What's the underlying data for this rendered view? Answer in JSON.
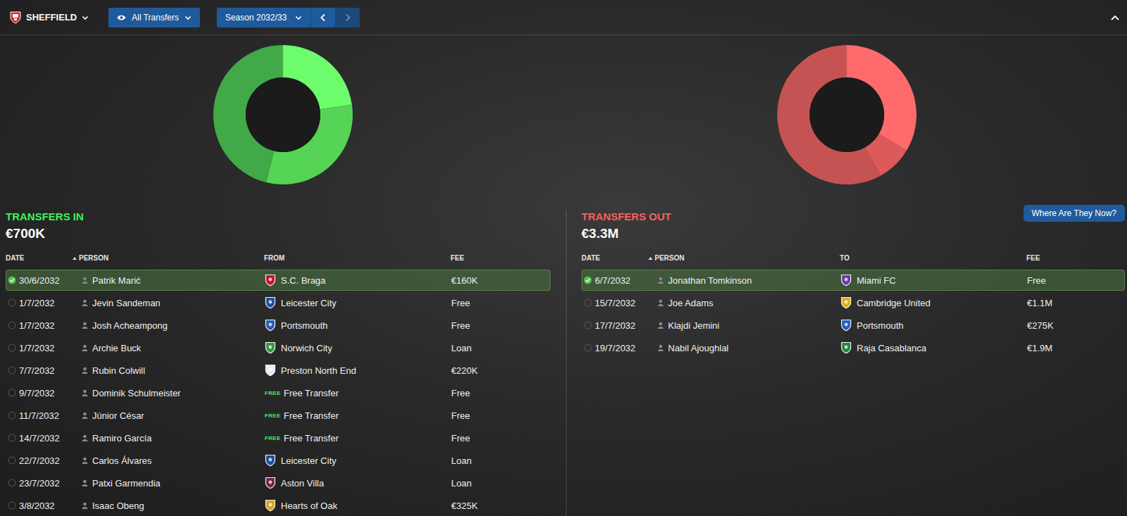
{
  "topbar": {
    "club": "SHEFFIELD",
    "view": "All Transfers",
    "season": "Season 2032/33",
    "prev_disabled": false,
    "next_disabled": true
  },
  "panels": [
    {
      "kind": "in",
      "title": "TRANSFERS IN",
      "total": "€700K",
      "donut": {
        "values": [
          160,
          220,
          325
        ],
        "colors": [
          "#6cfc6c",
          "#55d455",
          "#41a947"
        ]
      },
      "columns": [
        {
          "label": "DATE",
          "sorted": false
        },
        {
          "label": "PERSON",
          "sorted": true
        },
        {
          "label": "FROM",
          "sorted": false
        },
        {
          "label": "FEE",
          "sorted": false
        }
      ],
      "rows": [
        {
          "date": "30/6/2032",
          "person": "Patrik Marić",
          "club": "S.C. Braga",
          "kind": "club",
          "color": "#c8102e",
          "fee": "€160K",
          "selected": true
        },
        {
          "date": "1/7/2032",
          "person": "Jevin Sandeman",
          "club": "Leicester City",
          "kind": "club",
          "color": "#1d4fa0",
          "fee": "Free",
          "selected": false
        },
        {
          "date": "1/7/2032",
          "person": "Josh Acheampong",
          "club": "Portsmouth",
          "kind": "club",
          "color": "#2a5cb8",
          "fee": "Free",
          "selected": false
        },
        {
          "date": "1/7/2032",
          "person": "Archie Buck",
          "club": "Norwich City",
          "kind": "club",
          "color": "#2e9b3f",
          "fee": "Loan",
          "selected": false
        },
        {
          "date": "7/7/2032",
          "person": "Rubin Colwill",
          "club": "Preston North End",
          "kind": "club",
          "color": "#e8e8f0",
          "fee": "€220K",
          "selected": false
        },
        {
          "date": "9/7/2032",
          "person": "Dominik Schulmeister",
          "club": "Free Transfer",
          "kind": "free",
          "tag": "FREE",
          "fee": "Free",
          "selected": false
        },
        {
          "date": "11/7/2032",
          "person": "Júnior César",
          "club": "Free Transfer",
          "kind": "free",
          "tag": "FREE",
          "fee": "Free",
          "selected": false
        },
        {
          "date": "14/7/2032",
          "person": "Ramiro García",
          "club": "Free Transfer",
          "kind": "free",
          "tag": "FREE",
          "fee": "Free",
          "selected": false
        },
        {
          "date": "22/7/2032",
          "person": "Carlos Álvares",
          "club": "Leicester City",
          "kind": "club",
          "color": "#1d4fa0",
          "fee": "Loan",
          "selected": false
        },
        {
          "date": "23/7/2032",
          "person": "Patxi Garmendia",
          "club": "Aston Villa",
          "kind": "club",
          "color": "#7a1f4a",
          "fee": "Loan",
          "selected": false
        },
        {
          "date": "3/8/2032",
          "person": "Isaac Obeng",
          "club": "Hearts of Oak",
          "kind": "club",
          "color": "#d9a520",
          "fee": "€325K",
          "selected": false
        }
      ]
    },
    {
      "kind": "out",
      "title": "TRANSFERS OUT",
      "total": "€3.3M",
      "button": "Where Are They Now?",
      "donut": {
        "values": [
          1100,
          275,
          1900
        ],
        "colors": [
          "#ff6b6b",
          "#dc5a5a",
          "#c65353"
        ]
      },
      "columns": [
        {
          "label": "DATE",
          "sorted": false
        },
        {
          "label": "PERSON",
          "sorted": true
        },
        {
          "label": "TO",
          "sorted": false
        },
        {
          "label": "FEE",
          "sorted": false
        }
      ],
      "rows": [
        {
          "date": "6/7/2032",
          "person": "Jonathan Tomkinson",
          "club": "Miami FC",
          "kind": "club",
          "color": "#6a3aa8",
          "fee": "Free",
          "selected": true
        },
        {
          "date": "15/7/2032",
          "person": "Joe Adams",
          "club": "Cambridge United",
          "kind": "club",
          "color": "#e0b020",
          "fee": "€1.1M",
          "selected": false
        },
        {
          "date": "17/7/2032",
          "person": "Klajdi Jemini",
          "club": "Portsmouth",
          "kind": "club",
          "color": "#2a5cb8",
          "fee": "€275K",
          "selected": false
        },
        {
          "date": "19/7/2032",
          "person": "Nabil Ajoughlal",
          "club": "Raja Casablanca",
          "kind": "club",
          "color": "#1f8a3a",
          "fee": "€1.9M",
          "selected": false
        }
      ]
    }
  ]
}
